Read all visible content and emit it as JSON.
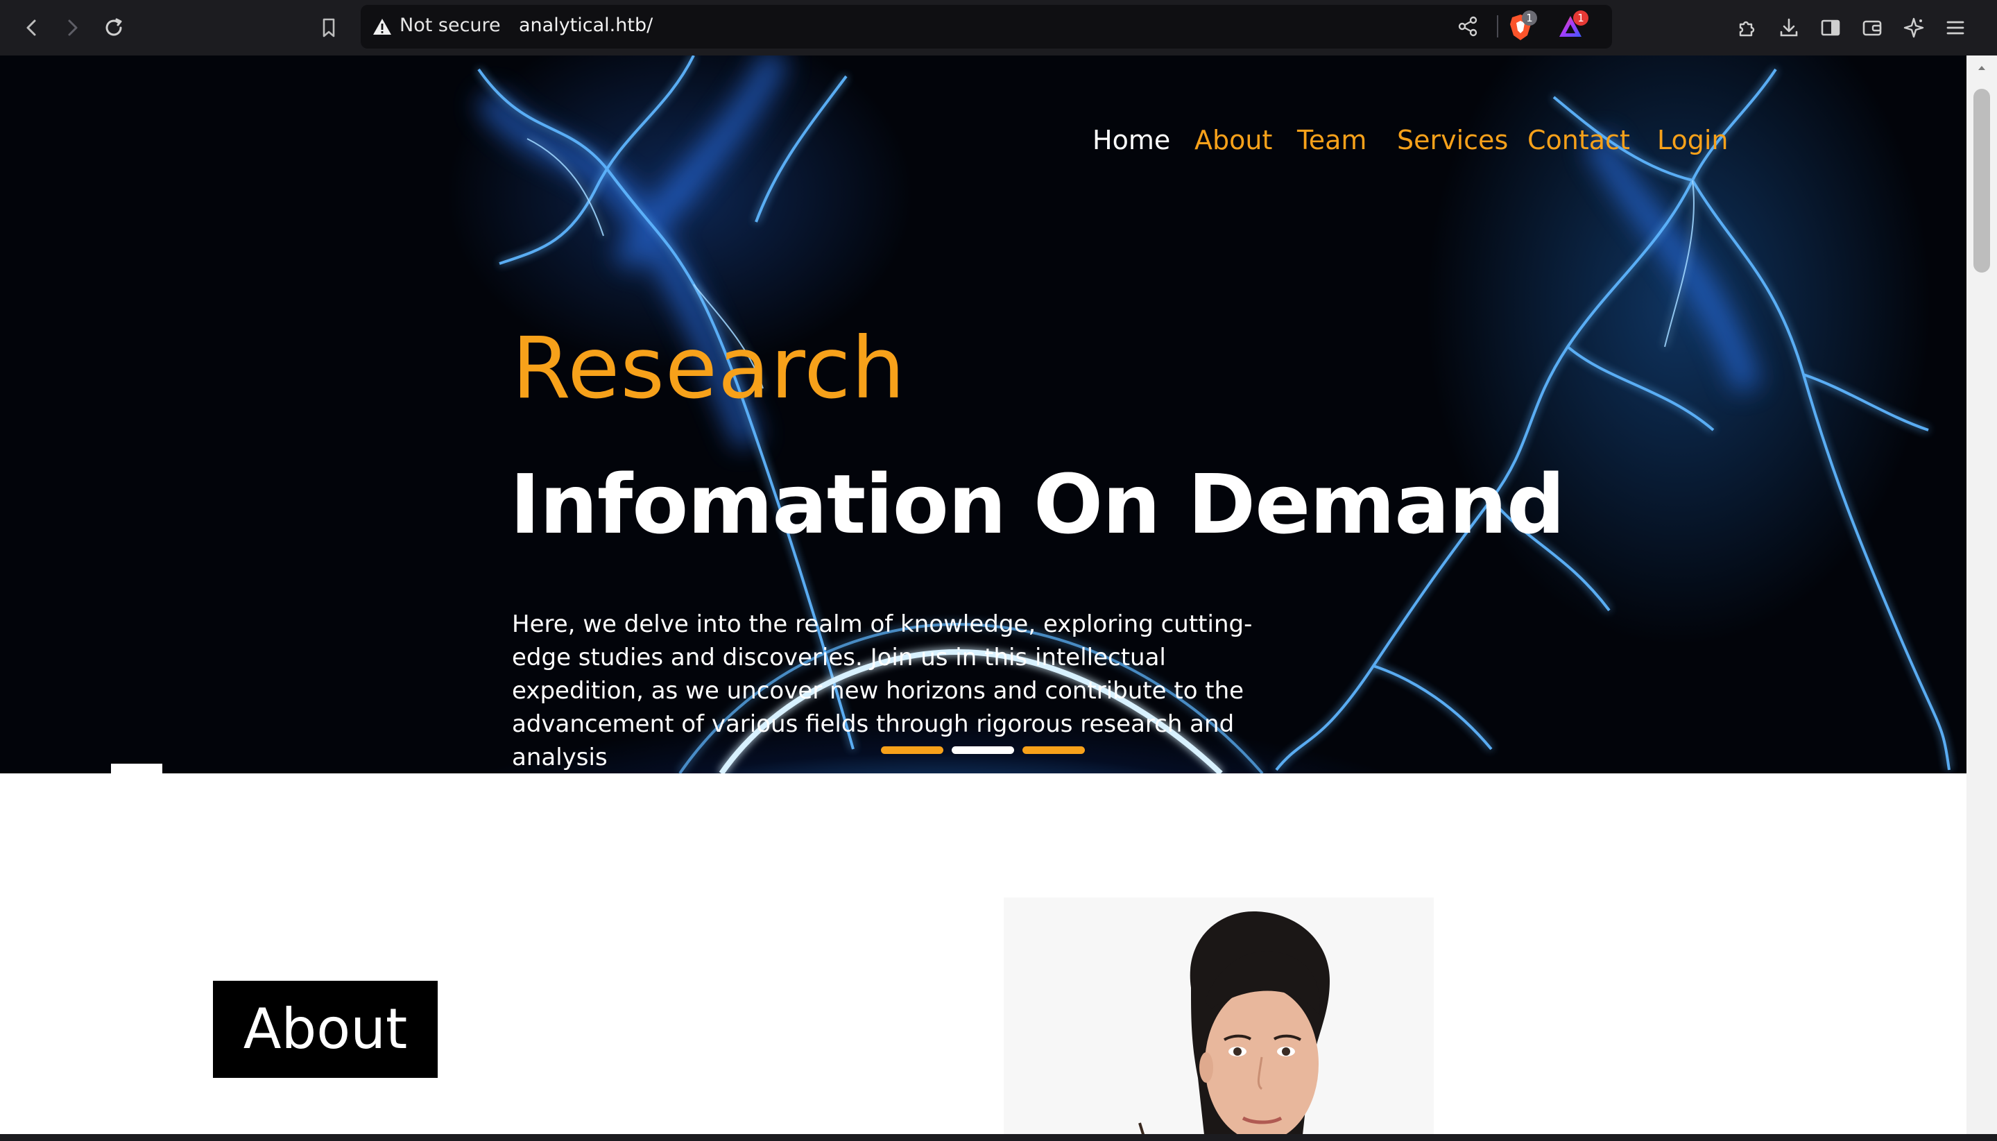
{
  "browser": {
    "security_label": "Not secure",
    "url": "analytical.htb/",
    "brave_shield_count": "1",
    "rewards_count": "1",
    "icons": {
      "back": "back-arrow-icon",
      "forward": "forward-arrow-icon",
      "reload": "reload-icon",
      "bookmark": "bookmark-icon",
      "warning": "warning-triangle-icon",
      "share": "share-icon",
      "brave": "brave-shield-icon",
      "rewards": "brave-rewards-icon",
      "extensions": "extensions-icon",
      "downloads": "download-icon",
      "sidebar": "sidebar-icon",
      "wallet": "wallet-icon",
      "leo": "leo-ai-icon",
      "menu": "hamburger-menu-icon"
    }
  },
  "nav": {
    "items": [
      {
        "label": "Home",
        "active": true
      },
      {
        "label": "About",
        "active": false
      },
      {
        "label": "Team",
        "active": false
      },
      {
        "label": "Services",
        "active": false
      },
      {
        "label": "Contact",
        "active": false
      },
      {
        "label": "Login",
        "active": false
      }
    ]
  },
  "hero": {
    "kicker": "Research",
    "title": "Infomation On Demand",
    "text": "Here, we delve into the realm of knowledge, exploring cutting-edge studies and discoveries. Join us in this intellectual expedition, as we uncover new horizons and contribute to the advancement of various fields through rigorous research and analysis",
    "slides": 3,
    "active_slide": 2
  },
  "about": {
    "title": "About"
  },
  "colors": {
    "accent": "#f7a11a",
    "chrome_bg": "#1c1c20",
    "hero_bg": "#02040a",
    "text_light": "#ffffff"
  }
}
